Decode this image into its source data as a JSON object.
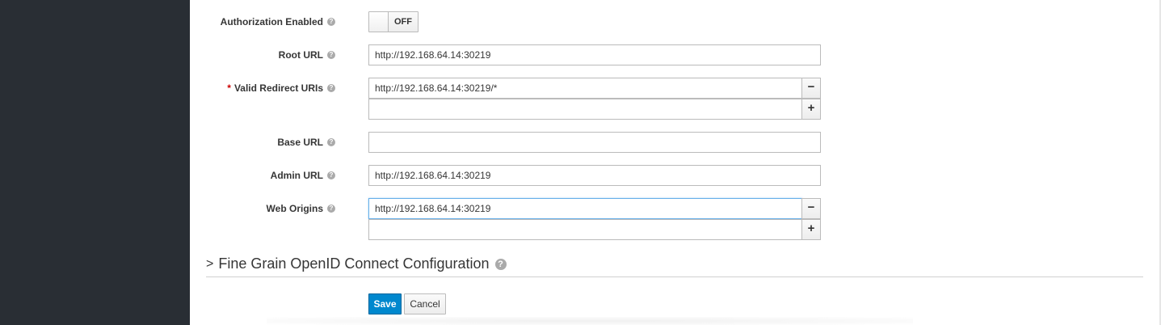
{
  "form": {
    "authorization": {
      "label": "Authorization Enabled",
      "toggle_text": "OFF"
    },
    "root_url": {
      "label": "Root URL",
      "value": "http://192.168.64.14:30219"
    },
    "redirect_uris": {
      "required_mark": "*",
      "label": "Valid Redirect URIs",
      "values": [
        "http://192.168.64.14:30219/*",
        ""
      ],
      "remove_label": "−",
      "add_label": "+"
    },
    "base_url": {
      "label": "Base URL",
      "value": ""
    },
    "admin_url": {
      "label": "Admin URL",
      "value": "http://192.168.64.14:30219"
    },
    "web_origins": {
      "label": "Web Origins",
      "values": [
        "http://192.168.64.14:30219",
        ""
      ],
      "remove_label": "−",
      "add_label": "+"
    }
  },
  "section": {
    "chevron": ">",
    "title": "Fine Grain OpenID Connect Configuration"
  },
  "actions": {
    "save_label": "Save",
    "cancel_label": "Cancel"
  },
  "help_glyph": "?",
  "icons": {
    "help": "question-circle-icon",
    "chevron": "chevron-right-icon"
  },
  "colors": {
    "sidebar": "#292e34",
    "primary": "#0088ce",
    "required": "#cc0000"
  }
}
